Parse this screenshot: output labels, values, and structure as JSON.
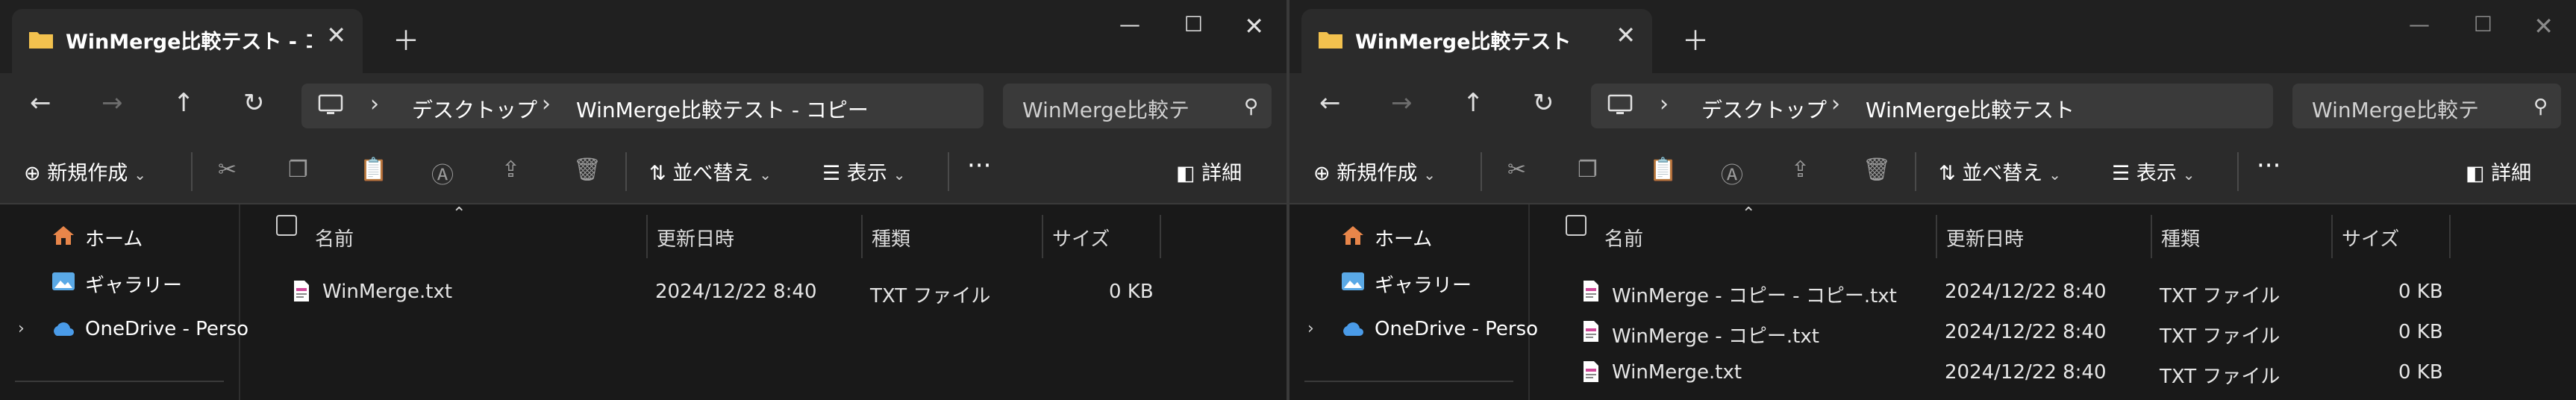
{
  "windows": [
    {
      "id": "left",
      "tab_title": "WinMerge比較テスト - コピー",
      "breadcrumb": [
        "デスクトップ",
        "WinMerge比較テスト - コピー"
      ],
      "search_placeholder": "WinMerge比較テ",
      "files": [
        {
          "name": "WinMerge.txt",
          "date": "2024/12/22 8:40",
          "type": "TXT ファイル",
          "size": "0 KB"
        }
      ]
    },
    {
      "id": "right",
      "tab_title": "WinMerge比較テスト",
      "breadcrumb": [
        "デスクトップ",
        "WinMerge比較テスト"
      ],
      "search_placeholder": "WinMerge比較テ",
      "files": [
        {
          "name": "WinMerge - コピー - コピー.txt",
          "date": "2024/12/22 8:40",
          "type": "TXT ファイル",
          "size": "0 KB"
        },
        {
          "name": "WinMerge - コピー.txt",
          "date": "2024/12/22 8:40",
          "type": "TXT ファイル",
          "size": "0 KB"
        },
        {
          "name": "WinMerge.txt",
          "date": "2024/12/22 8:40",
          "type": "TXT ファイル",
          "size": "0 KB"
        }
      ]
    }
  ],
  "toolbar": {
    "new_label": "新規作成",
    "sort_label": "並べ替え",
    "view_label": "表示",
    "more_label": "···",
    "details_label": "詳細"
  },
  "nav": {
    "home": "ホーム",
    "gallery": "ギャラリー",
    "onedrive": "OneDrive - Perso"
  },
  "columns": {
    "name": "名前",
    "date": "更新日時",
    "type": "種類",
    "size": "サイズ"
  },
  "colors": {
    "folder": "#f2c14e",
    "onedrive": "#4a9be8",
    "home": "#e8864a",
    "gallery": "#5aa9e6"
  }
}
